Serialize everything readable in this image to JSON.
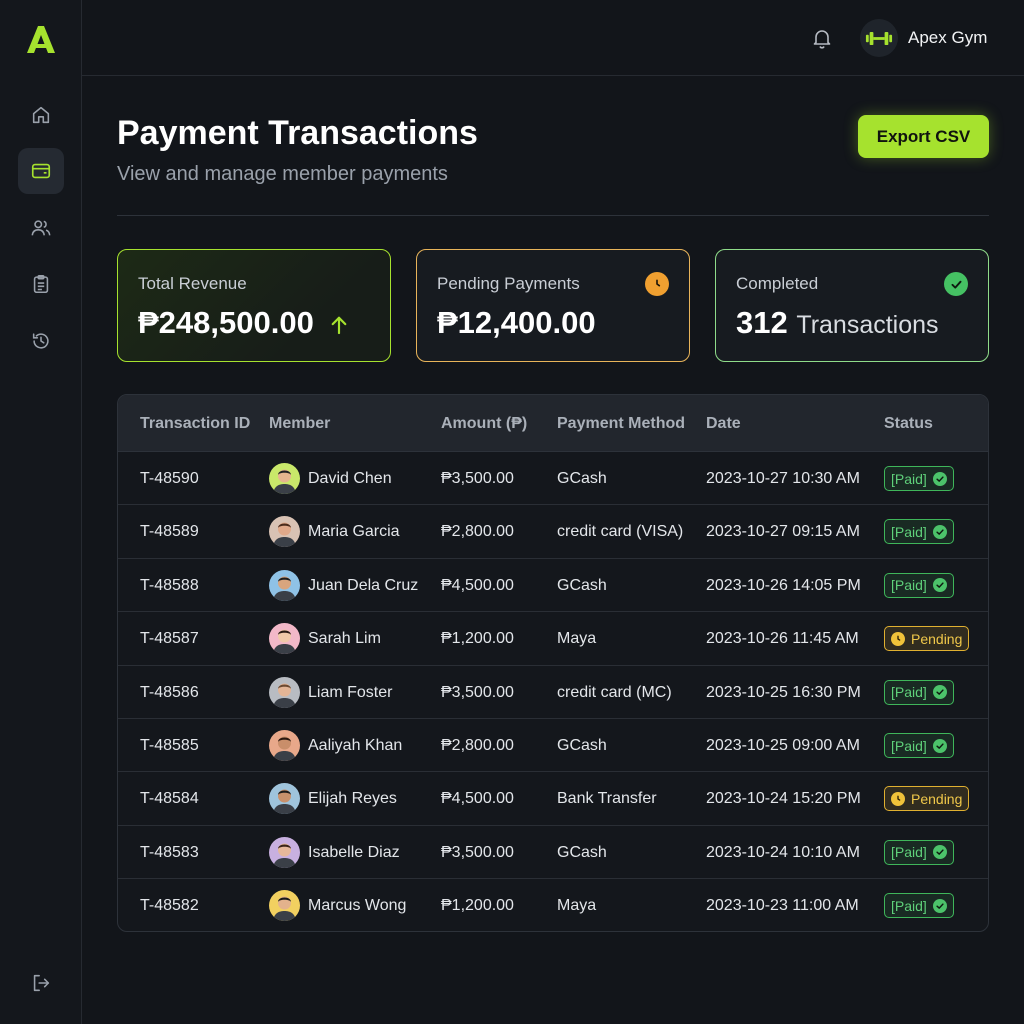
{
  "brand": {
    "logo_letter": "A",
    "accent": "#a6e22e"
  },
  "topbar": {
    "gym_name": "Apex Gym"
  },
  "sidebar": {
    "items": [
      {
        "icon": "home-icon"
      },
      {
        "icon": "wallet-icon",
        "active": true
      },
      {
        "icon": "users-icon"
      },
      {
        "icon": "clipboard-icon"
      },
      {
        "icon": "history-icon"
      }
    ],
    "bottom": {
      "icon": "logout-icon"
    }
  },
  "header": {
    "title": "Payment Transactions",
    "subtitle": "View and manage member payments",
    "export_label": "Export CSV"
  },
  "cards": {
    "revenue": {
      "label": "Total Revenue",
      "value": "₱248,500.00"
    },
    "pending": {
      "label": "Pending Payments",
      "value": "₱12,400.00"
    },
    "completed": {
      "label": "Completed",
      "value": "312",
      "unit": "Transactions"
    }
  },
  "table": {
    "columns": [
      "Transaction ID",
      "Member",
      "Amount (₱)",
      "Payment Method",
      "Date",
      "Status"
    ],
    "rows": [
      {
        "id": "T-48590",
        "member": "David Chen",
        "amount": "₱3,500.00",
        "method": "GCash",
        "date": "2023-10-27 10:30 AM",
        "status": "[Paid]",
        "type": "paid",
        "avatar_bg": "#c9e86a",
        "skin": "#e6b58e",
        "hair": "#222222"
      },
      {
        "id": "T-48589",
        "member": "Maria Garcia",
        "amount": "₱2,800.00",
        "method": "credit card (VISA)",
        "date": "2023-10-27 09:15 AM",
        "status": "[Paid]",
        "type": "paid",
        "avatar_bg": "#d8c2b4",
        "skin": "#e0a98a",
        "hair": "#4a2c1d"
      },
      {
        "id": "T-48588",
        "member": "Juan Dela Cruz",
        "amount": "₱4,500.00",
        "method": "GCash",
        "date": "2023-10-26 14:05 PM",
        "status": "[Paid]",
        "type": "paid",
        "avatar_bg": "#8fc2e6",
        "skin": "#d8a57e",
        "hair": "#1e1e1e"
      },
      {
        "id": "T-48587",
        "member": "Sarah Lim",
        "amount": "₱1,200.00",
        "method": "Maya",
        "date": "2023-10-26 11:45 AM",
        "status": "Pending",
        "type": "pending",
        "avatar_bg": "#f2b8c8",
        "skin": "#f0c9a8",
        "hair": "#2a1a14"
      },
      {
        "id": "T-48586",
        "member": "Liam Foster",
        "amount": "₱3,500.00",
        "method": "credit card (MC)",
        "date": "2023-10-25 16:30 PM",
        "status": "[Paid]",
        "type": "paid",
        "avatar_bg": "#b8bcc2",
        "skin": "#e3b596",
        "hair": "#6b4a32"
      },
      {
        "id": "T-48585",
        "member": "Aaliyah Khan",
        "amount": "₱2,800.00",
        "method": "GCash",
        "date": "2023-10-25 09:00 AM",
        "status": "[Paid]",
        "type": "paid",
        "avatar_bg": "#e8a88a",
        "skin": "#c98e6a",
        "hair": "#2a1810"
      },
      {
        "id": "T-48584",
        "member": "Elijah Reyes",
        "amount": "₱4,500.00",
        "method": "Bank Transfer",
        "date": "2023-10-24 15:20 PM",
        "status": "Pending",
        "type": "pending",
        "avatar_bg": "#9fc4dc",
        "skin": "#c8916c",
        "hair": "#1c1c1c"
      },
      {
        "id": "T-48583",
        "member": "Isabelle Diaz",
        "amount": "₱3,500.00",
        "method": "GCash",
        "date": "2023-10-24 10:10 AM",
        "status": "[Paid]",
        "type": "paid",
        "avatar_bg": "#c8b0e0",
        "skin": "#e6b89a",
        "hair": "#3a2418"
      },
      {
        "id": "T-48582",
        "member": "Marcus Wong",
        "amount": "₱1,200.00",
        "method": "Maya",
        "date": "2023-10-23 11:00 AM",
        "status": "[Paid]",
        "type": "paid",
        "avatar_bg": "#f2d060",
        "skin": "#e3b28c",
        "hair": "#1a1a1a"
      }
    ]
  }
}
